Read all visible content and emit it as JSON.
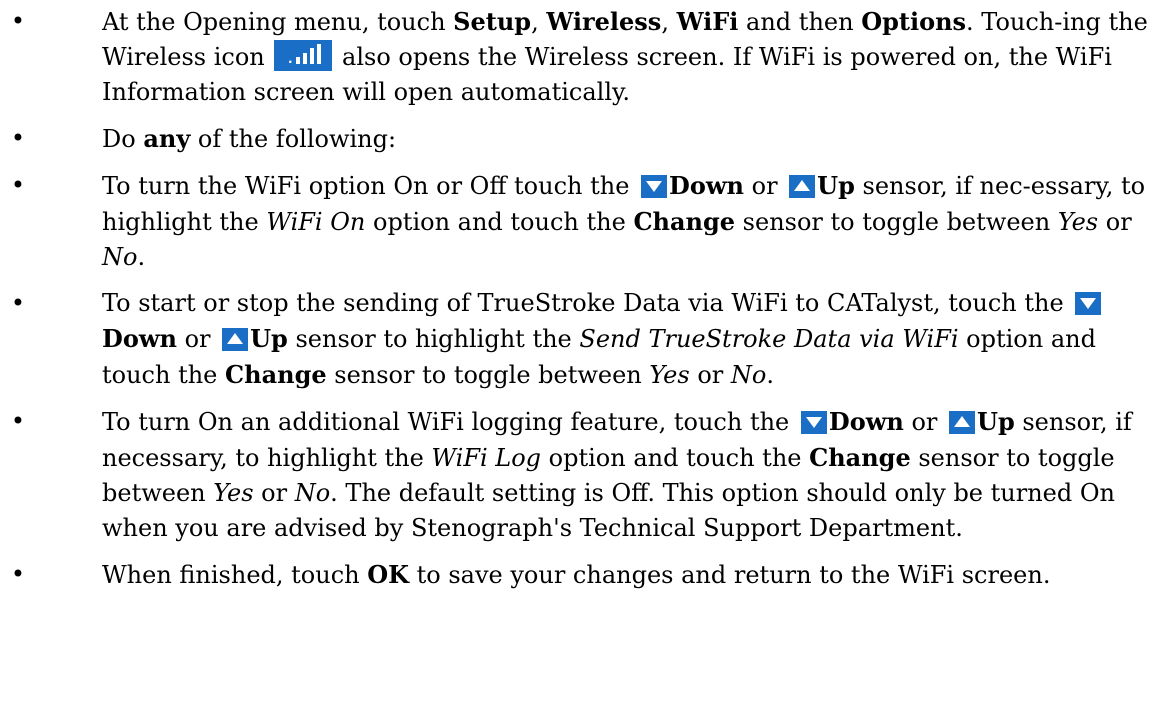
{
  "bullet": "•",
  "icons": {
    "wireless": "wireless-signal-icon",
    "down": "down-arrow-icon",
    "up": "up-arrow-icon",
    "icon_color": "#1a6ec5"
  },
  "items": [
    {
      "p1": "At the Opening menu, touch ",
      "b1": "Setup",
      "p2": ", ",
      "b2": "Wireless",
      "p3": ", ",
      "b3": "WiFi",
      "p4": " and then ",
      "b4": "Options",
      "p5": ". Touch-ing the Wireless icon ",
      "p6": " also opens the Wireless screen. If WiFi is powered on, the WiFi Information screen will open automatically."
    },
    {
      "p1": "Do ",
      "b1": "any",
      "p2": " of the following:"
    },
    {
      "p1": "To turn the WiFi option On or Off touch the ",
      "down": "Down",
      "or": " or ",
      "up": "Up",
      "p2": " sensor, if nec-essary, to highlight the ",
      "i1": "WiFi On",
      "p3": " option and touch the ",
      "b1": "Change",
      "p4": " sensor to toggle between ",
      "i2": "Yes",
      "p5": " or ",
      "i3": "No",
      "p6": "."
    },
    {
      "p1": "To start or stop the sending of TrueStroke Data via WiFi to CATalyst, touch the ",
      "down": "Down",
      "or": " or ",
      "up": "Up",
      "p2": " sensor to highlight the ",
      "i1": "Send TrueStroke Data via WiFi",
      "p3": " option and touch the ",
      "b1": "Change",
      "p4": " sensor to toggle between ",
      "i2": "Yes",
      "p5": " or ",
      "i3": "No",
      "p6": "."
    },
    {
      "p1": "To turn On an additional WiFi logging feature, touch the ",
      "down": "Down",
      "or": " or ",
      "up": "Up",
      "p2": " sensor, if necessary, to highlight the ",
      "i1": "WiFi Log",
      "p3": " option and touch the ",
      "b1": "Change",
      "p4": " sensor to toggle between ",
      "i2": "Yes",
      "p5": " or ",
      "i3": "No",
      "p6": ". The default setting is Off. This option should only be turned On when you are advised by Stenograph's Technical Support Department."
    },
    {
      "p1": "When finished, touch ",
      "b1": "OK",
      "p2": " to save your changes and return to the WiFi screen."
    }
  ]
}
